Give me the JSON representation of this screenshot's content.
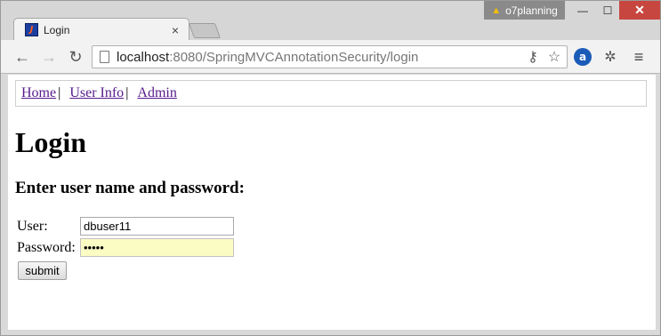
{
  "window": {
    "profile_name": "o7planning",
    "minimize_glyph": "—",
    "maximize_glyph": "☐",
    "close_glyph": "✕"
  },
  "tab": {
    "title": "Login",
    "favicon_text": "J",
    "close_glyph": "×"
  },
  "toolbar": {
    "back_glyph": "←",
    "forward_glyph": "→",
    "reload_glyph": "↻",
    "url_host": "localhost",
    "url_rest": ":8080/SpringMVCAnnotationSecurity/login",
    "key_glyph": "⚷",
    "star_glyph": "☆",
    "ext_a_label": "a",
    "bug_glyph": "✲",
    "menu_glyph": "≡"
  },
  "nav": {
    "home": "Home",
    "user_info": "User Info",
    "admin": "Admin",
    "separator": "|"
  },
  "page": {
    "heading": "Login",
    "subheading": "Enter user name and password:"
  },
  "form": {
    "user_label": "User:",
    "user_value": "dbuser11",
    "password_label": "Password:",
    "password_value": "•••••",
    "submit_label": "submit"
  }
}
